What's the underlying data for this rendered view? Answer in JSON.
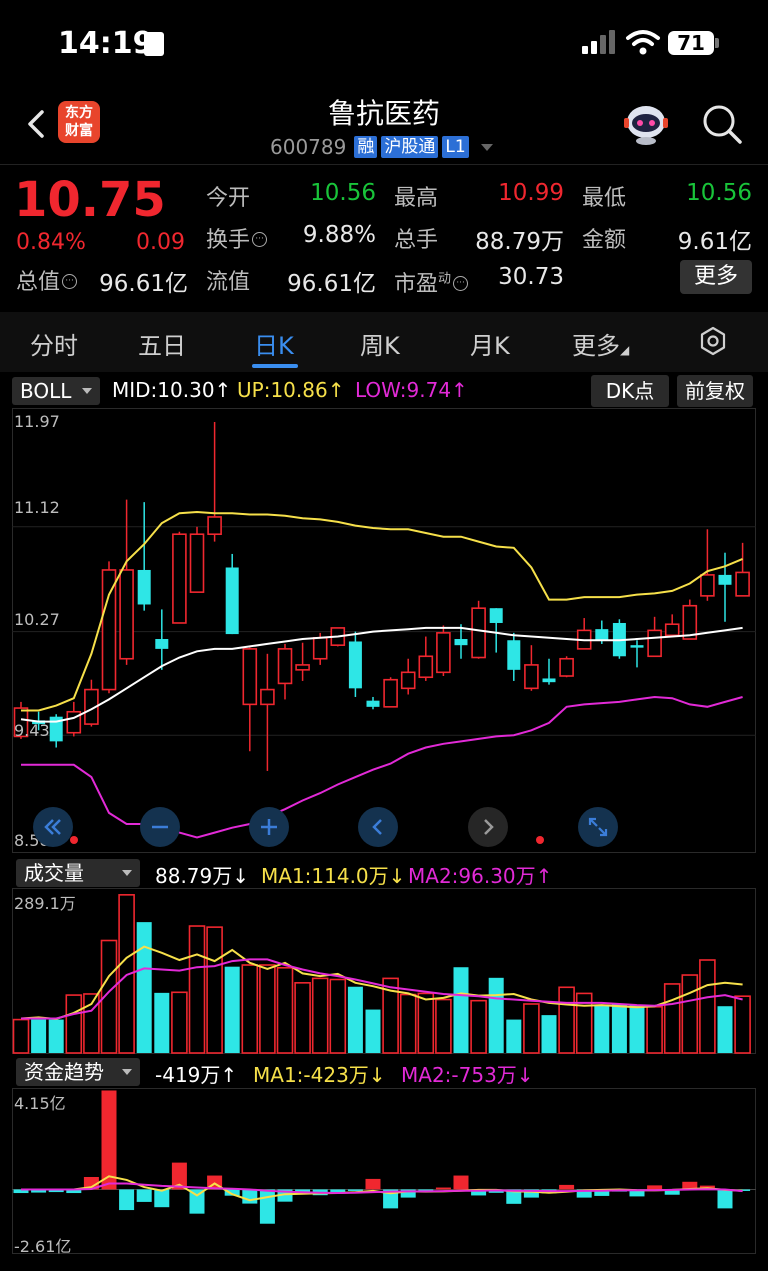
{
  "status": {
    "time": "14:19",
    "battery": "71"
  },
  "header": {
    "stock_name": "鲁抗医药",
    "code": "600789",
    "tags": [
      "融",
      "沪股通",
      "L1"
    ],
    "logo_line1": "东方",
    "logo_line2": "财富"
  },
  "quote": {
    "price": "10.75",
    "change_pct": "0.84%",
    "change_amt": "0.09",
    "market_cap_label": "总值",
    "market_cap": "96.61亿",
    "fields": [
      {
        "label": "今开",
        "value": "10.56",
        "color": "green"
      },
      {
        "label": "最高",
        "value": "10.99",
        "color": "red"
      },
      {
        "label": "最低",
        "value": "10.56",
        "color": "green"
      },
      {
        "label": "换手",
        "value": "9.88%",
        "color": "white"
      },
      {
        "label": "总手",
        "value": "88.79万",
        "color": "white"
      },
      {
        "label": "金额",
        "value": "9.61亿",
        "color": "white"
      },
      {
        "label": "流值",
        "value": "96.61亿",
        "color": "white"
      },
      {
        "label": "市盈",
        "sup": "动",
        "value": "30.73",
        "color": "white"
      }
    ],
    "more_label": "更多"
  },
  "tabs": [
    "分时",
    "五日",
    "日K",
    "周K",
    "月K",
    "更多"
  ],
  "active_tab": 2,
  "boll": {
    "dropdown": "BOLL",
    "mid": "MID:10.30↑",
    "up": "UP:10.86↑",
    "low": "LOW:9.74↑",
    "dk_label": "DK点",
    "fq_label": "前复权",
    "y_labels": [
      "11.97",
      "11.12",
      "10.27",
      "9.43",
      "8.58"
    ]
  },
  "volume": {
    "dropdown": "成交量",
    "value": "88.79万↓",
    "ma1": "MA1:114.0万↓",
    "ma2": "MA2:96.30万↑",
    "y_max_label": "289.1万"
  },
  "fund": {
    "dropdown": "资金趋势",
    "value": "-419万↑",
    "ma1": "MA1:-423万↓",
    "ma2": "MA2:-753万↓",
    "y_max_label": "4.15亿",
    "y_min_label": "-2.61亿"
  },
  "colors": {
    "up": "#f0272f",
    "down": "#2ee6e6",
    "mid_line": "#ffffff",
    "up_line": "#f6e04a",
    "low_line": "#e22ad7",
    "accent": "#3a8ef0"
  },
  "chart_data": [
    {
      "type": "candlestick",
      "title": "",
      "ylim": [
        8.58,
        11.97
      ],
      "candles": [
        {
          "o": 9.42,
          "c": 9.65,
          "h": 9.7,
          "l": 9.4
        },
        {
          "o": 9.55,
          "c": 9.52,
          "h": 9.62,
          "l": 9.47
        },
        {
          "o": 9.58,
          "c": 9.38,
          "h": 9.6,
          "l": 9.33
        },
        {
          "o": 9.45,
          "c": 9.62,
          "h": 9.7,
          "l": 9.42
        },
        {
          "o": 9.52,
          "c": 9.8,
          "h": 9.88,
          "l": 9.5
        },
        {
          "o": 9.8,
          "c": 10.77,
          "h": 10.84,
          "l": 9.77
        },
        {
          "o": 10.05,
          "c": 10.77,
          "h": 11.34,
          "l": 10.0
        },
        {
          "o": 10.77,
          "c": 10.49,
          "h": 11.32,
          "l": 10.44
        },
        {
          "o": 10.21,
          "c": 10.13,
          "h": 10.45,
          "l": 9.96
        },
        {
          "o": 10.34,
          "c": 11.06,
          "h": 11.08,
          "l": 10.34
        },
        {
          "o": 10.59,
          "c": 11.06,
          "h": 11.12,
          "l": 10.59
        },
        {
          "o": 11.06,
          "c": 11.2,
          "h": 11.97,
          "l": 11.0
        },
        {
          "o": 10.79,
          "c": 10.25,
          "h": 10.9,
          "l": 10.25
        },
        {
          "o": 9.68,
          "c": 10.13,
          "h": 10.14,
          "l": 9.3
        },
        {
          "o": 9.68,
          "c": 9.8,
          "h": 10.09,
          "l": 9.14
        },
        {
          "o": 9.85,
          "c": 10.13,
          "h": 10.17,
          "l": 9.72
        },
        {
          "o": 9.96,
          "c": 10.0,
          "h": 10.18,
          "l": 9.87
        },
        {
          "o": 10.05,
          "c": 10.22,
          "h": 10.26,
          "l": 10.0
        },
        {
          "o": 10.16,
          "c": 10.3,
          "h": 10.3,
          "l": 10.15
        },
        {
          "o": 10.19,
          "c": 9.81,
          "h": 10.27,
          "l": 9.74
        },
        {
          "o": 9.71,
          "c": 9.66,
          "h": 9.74,
          "l": 9.64
        },
        {
          "o": 9.66,
          "c": 9.88,
          "h": 9.9,
          "l": 9.66
        },
        {
          "o": 9.81,
          "c": 9.94,
          "h": 10.05,
          "l": 9.76
        },
        {
          "o": 9.9,
          "c": 10.07,
          "h": 10.23,
          "l": 9.87
        },
        {
          "o": 9.94,
          "c": 10.26,
          "h": 10.32,
          "l": 9.91
        },
        {
          "o": 10.21,
          "c": 10.16,
          "h": 10.33,
          "l": 10.05
        },
        {
          "o": 10.06,
          "c": 10.46,
          "h": 10.52,
          "l": 10.05
        },
        {
          "o": 10.46,
          "c": 10.34,
          "h": 10.46,
          "l": 10.1
        },
        {
          "o": 10.2,
          "c": 9.96,
          "h": 10.26,
          "l": 9.87
        },
        {
          "o": 9.81,
          "c": 10.0,
          "h": 10.16,
          "l": 9.79
        },
        {
          "o": 9.89,
          "c": 9.86,
          "h": 10.05,
          "l": 9.84
        },
        {
          "o": 9.91,
          "c": 10.05,
          "h": 10.07,
          "l": 9.9
        },
        {
          "o": 10.13,
          "c": 10.28,
          "h": 10.38,
          "l": 10.13
        },
        {
          "o": 10.29,
          "c": 10.2,
          "h": 10.36,
          "l": 10.17
        },
        {
          "o": 10.34,
          "c": 10.07,
          "h": 10.37,
          "l": 10.05
        },
        {
          "o": 10.16,
          "c": 10.14,
          "h": 10.2,
          "l": 9.98
        },
        {
          "o": 10.07,
          "c": 10.28,
          "h": 10.39,
          "l": 10.07
        },
        {
          "o": 10.24,
          "c": 10.33,
          "h": 10.41,
          "l": 10.24
        },
        {
          "o": 10.21,
          "c": 10.48,
          "h": 10.53,
          "l": 10.21
        },
        {
          "o": 10.56,
          "c": 10.73,
          "h": 11.1,
          "l": 10.52
        },
        {
          "o": 10.73,
          "c": 10.65,
          "h": 10.91,
          "l": 10.35
        },
        {
          "o": 10.56,
          "c": 10.75,
          "h": 10.99,
          "l": 10.56
        }
      ],
      "boll_mid": [
        9.56,
        9.54,
        9.54,
        9.57,
        9.64,
        9.72,
        9.81,
        9.9,
        9.99,
        10.06,
        10.11,
        10.13,
        10.13,
        10.15,
        10.17,
        10.19,
        10.21,
        10.22,
        10.23,
        10.25,
        10.27,
        10.28,
        10.29,
        10.3,
        10.3,
        10.3,
        10.28,
        10.26,
        10.24,
        10.23,
        10.22,
        10.21,
        10.2,
        10.2,
        10.2,
        10.21,
        10.22,
        10.23,
        10.24,
        10.26,
        10.28,
        10.3
      ],
      "boll_up": [
        9.63,
        9.63,
        9.67,
        9.73,
        10.09,
        10.57,
        10.84,
        10.98,
        11.15,
        11.23,
        11.24,
        11.23,
        11.23,
        11.22,
        11.22,
        11.21,
        11.19,
        11.18,
        11.16,
        11.13,
        11.11,
        11.1,
        11.1,
        11.07,
        11.04,
        11.04,
        11.0,
        10.96,
        10.95,
        10.79,
        10.53,
        10.53,
        10.55,
        10.55,
        10.55,
        10.57,
        10.58,
        10.6,
        10.66,
        10.76,
        10.8,
        10.86
      ],
      "boll_low": [
        9.19,
        9.19,
        9.19,
        9.19,
        9.09,
        8.8,
        8.71,
        8.71,
        8.69,
        8.64,
        8.6,
        8.64,
        8.68,
        8.71,
        8.77,
        8.83,
        8.9,
        8.96,
        9.03,
        9.09,
        9.15,
        9.2,
        9.28,
        9.33,
        9.36,
        9.38,
        9.4,
        9.42,
        9.43,
        9.47,
        9.53,
        9.66,
        9.68,
        9.69,
        9.7,
        9.72,
        9.74,
        9.73,
        9.68,
        9.66,
        9.7,
        9.74
      ]
    },
    {
      "type": "bar",
      "title": "成交量",
      "ylim": [
        0,
        289.1
      ],
      "values": [
        60,
        60,
        60,
        104,
        106,
        202,
        284,
        235,
        108,
        109,
        228,
        226,
        155,
        158,
        158,
        153,
        126,
        134,
        132,
        119,
        78,
        134,
        105,
        107,
        96,
        154,
        94,
        135,
        60,
        88,
        68,
        118,
        107,
        85,
        88,
        86,
        83,
        124,
        140,
        167,
        84,
        102
      ],
      "ma1": [
        62,
        64,
        61,
        72,
        88,
        138,
        171,
        191,
        180,
        167,
        177,
        165,
        185,
        162,
        151,
        162,
        143,
        138,
        142,
        126,
        120,
        112,
        107,
        96,
        99,
        107,
        103,
        104,
        106,
        96,
        90,
        87,
        85,
        86,
        84,
        82,
        84,
        95,
        108,
        122,
        126,
        123
      ],
      "ma2": [
        62,
        62,
        62,
        70,
        76,
        110,
        140,
        152,
        150,
        148,
        154,
        156,
        165,
        168,
        168,
        158,
        150,
        143,
        138,
        132,
        125,
        118,
        114,
        110,
        106,
        104,
        102,
        98,
        96,
        94,
        92,
        90,
        90,
        90,
        88,
        86,
        85,
        88,
        94,
        100,
        104,
        96
      ]
    },
    {
      "type": "bar",
      "title": "资金趋势",
      "ylim": [
        -2.61,
        4.15
      ],
      "values": [
        -0.15,
        -0.13,
        -0.11,
        -0.15,
        0.52,
        4.13,
        -0.86,
        -0.52,
        -0.74,
        1.12,
        -1.01,
        0.58,
        -0.26,
        -0.59,
        -1.43,
        -0.51,
        -0.11,
        -0.24,
        -0.14,
        -0.05,
        0.44,
        -0.79,
        -0.34,
        -0.09,
        0.08,
        0.58,
        -0.25,
        -0.14,
        -0.6,
        -0.34,
        -0.16,
        0.19,
        -0.34,
        -0.27,
        -0.09,
        -0.29,
        0.17,
        -0.22,
        0.32,
        0.16,
        -0.79,
        -0.04
      ],
      "ma1": [
        0,
        0,
        0,
        0,
        0.1,
        0.55,
        0.4,
        0.1,
        -0.05,
        0.2,
        -0.25,
        0.25,
        -0.2,
        -0.45,
        -0.32,
        -0.2,
        -0.18,
        -0.16,
        -0.15,
        -0.12,
        -0.06,
        -0.16,
        -0.08,
        -0.09,
        -0.08,
        -0.05,
        -0.02,
        -0.02,
        -0.08,
        -0.09,
        -0.14,
        -0.1,
        -0.04,
        -0.02,
        0,
        -0.03,
        -0.04,
        -0.02,
        0.02,
        0.05,
        -0.02,
        -0.05
      ],
      "ma2": [
        0,
        0,
        0,
        0,
        0.02,
        0.25,
        0.25,
        0.2,
        0.15,
        0.12,
        0.08,
        0.05,
        0.03,
        0,
        -0.05,
        -0.09,
        -0.12,
        -0.14,
        -0.15,
        -0.14,
        -0.11,
        -0.09,
        -0.08,
        -0.08,
        -0.07,
        -0.05,
        -0.05,
        -0.04,
        -0.05,
        -0.06,
        -0.07,
        -0.07,
        -0.06,
        -0.05,
        -0.04,
        -0.03,
        -0.03,
        -0.02,
        0,
        0.01,
        0,
        -0.07
      ]
    }
  ]
}
